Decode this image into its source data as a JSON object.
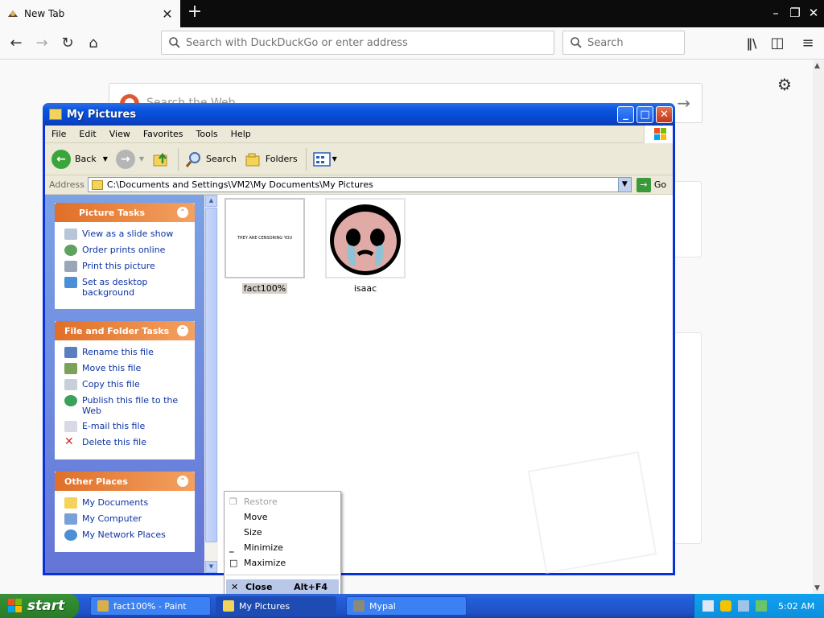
{
  "firefox": {
    "tab_title": "New Tab",
    "urlbar_placeholder": "Search with DuckDuckGo or enter address",
    "search_placeholder": "Search",
    "websearch_placeholder": "Search the Web"
  },
  "explorer": {
    "title": "My Pictures",
    "menu": [
      "File",
      "Edit",
      "View",
      "Favorites",
      "Tools",
      "Help"
    ],
    "toolbar": {
      "back": "Back",
      "search": "Search",
      "folders": "Folders"
    },
    "address_label": "Address",
    "address_value": "C:\\Documents and Settings\\VM2\\My Documents\\My Pictures",
    "go_label": "Go",
    "panels": [
      {
        "title": "Picture Tasks",
        "items": [
          "View as a slide show",
          "Order prints online",
          "Print this picture",
          "Set as desktop background"
        ]
      },
      {
        "title": "File and Folder Tasks",
        "items": [
          "Rename this file",
          "Move this file",
          "Copy this file",
          "Publish this file to the Web",
          "E-mail this file",
          "Delete this file"
        ]
      },
      {
        "title": "Other Places",
        "items": [
          "My Documents",
          "My Computer",
          "My Network Places"
        ]
      }
    ],
    "files": [
      {
        "name": "fact100%",
        "thumb_text": "THEY ARE CENSORING YOU",
        "selected": true
      },
      {
        "name": "isaac",
        "selected": false
      }
    ]
  },
  "context_menu": {
    "items": [
      {
        "label": "Restore",
        "enabled": false
      },
      {
        "label": "Move",
        "enabled": true
      },
      {
        "label": "Size",
        "enabled": true
      },
      {
        "label": "Minimize",
        "enabled": true
      },
      {
        "label": "Maximize",
        "enabled": true
      },
      {
        "label": "Close",
        "shortcut": "Alt+F4",
        "enabled": true,
        "highlighted": true
      }
    ]
  },
  "taskbar": {
    "start_label": "start",
    "tasks": [
      {
        "label": "fact100% - Paint",
        "active": false
      },
      {
        "label": "My Pictures",
        "active": true
      },
      {
        "label": "Mypal",
        "active": false
      }
    ],
    "clock": "5:02 AM"
  },
  "colors": {
    "xp_title_blue": "#0a55e0",
    "xp_task_orange": "#e06f28",
    "start_green": "#2e8b2e",
    "taskbar_blue": "#245edb"
  }
}
